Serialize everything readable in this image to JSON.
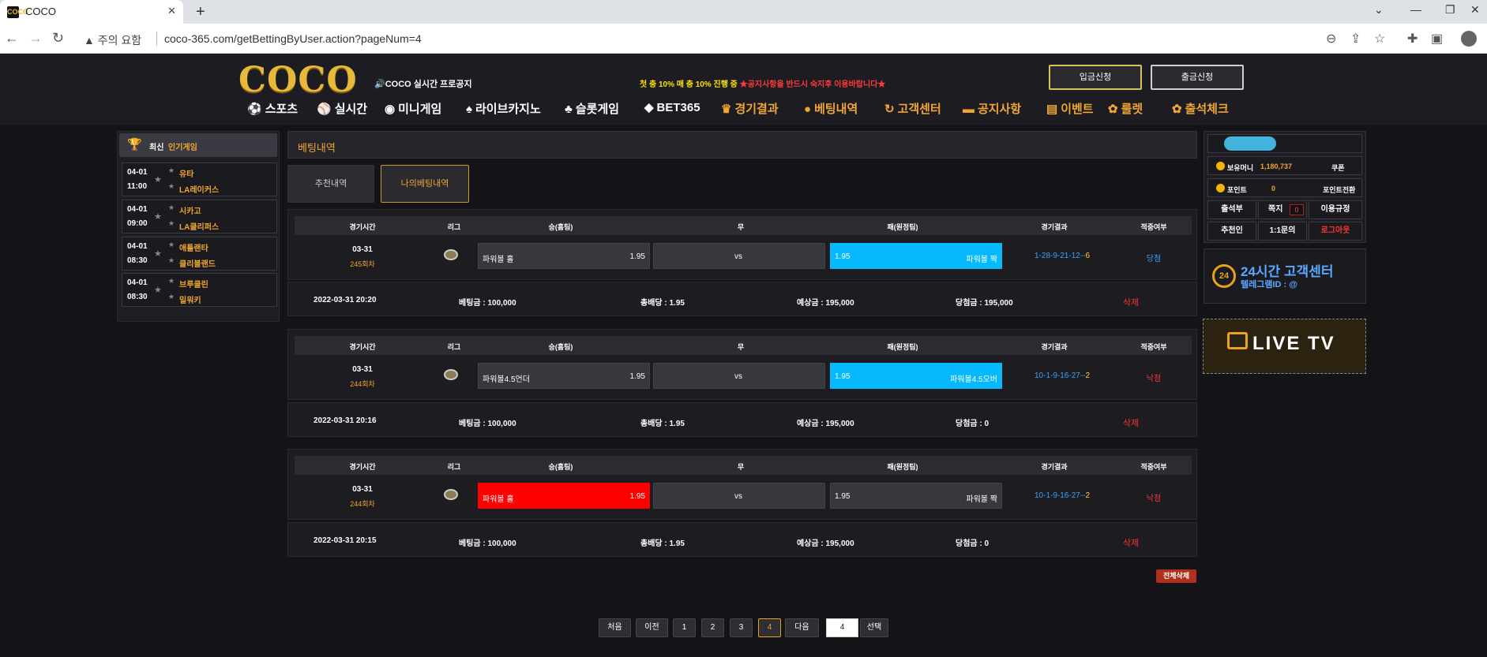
{
  "browser": {
    "tab_title": "COCO",
    "tab_favicon": "COCO",
    "security_label": "주의 요함",
    "url": "coco-365.com/getBettingByUser.action?pageNum=4"
  },
  "header": {
    "logo": "COCO",
    "notice_label": "🔊COCO 실시간 프로공지",
    "promo_yellow": "첫 충 10% 매 충 10% 진행 중",
    "promo_red": " ★공지사항을 반드시 숙지후 이용바랍니다★",
    "deposit_label": "입금신청",
    "withdraw_label": "출금신청",
    "menu": [
      {
        "label": "스포츠",
        "icon": "⚽",
        "color": "#ffffff"
      },
      {
        "label": "실시간",
        "icon": "⚾",
        "color": "#ffffff"
      },
      {
        "label": "미니게임",
        "icon": "◉",
        "color": "#ffffff"
      },
      {
        "label": "라이브카지노",
        "icon": "♠",
        "color": "#ffffff"
      },
      {
        "label": "슬롯게임",
        "icon": "♣",
        "color": "#ffffff"
      },
      {
        "label": "BET365",
        "icon": "◆",
        "color": "#ffffff"
      },
      {
        "label": "경기결과",
        "icon": "♛",
        "color": "#f0a630"
      },
      {
        "label": "베팅내역",
        "icon": "●",
        "color": "#f0a630"
      },
      {
        "label": "고객센터",
        "icon": "↻",
        "color": "#f0a630"
      },
      {
        "label": "공지사항",
        "icon": "▬",
        "color": "#f0a630"
      },
      {
        "label": "이벤트",
        "icon": "▤",
        "color": "#f0a630"
      },
      {
        "label": "룰렛",
        "icon": "✿",
        "color": "#f0a630"
      },
      {
        "label": "출석체크",
        "icon": "✿",
        "color": "#f0a630"
      }
    ]
  },
  "sidebar": {
    "title_white": "최신",
    "title_orange": "인기게임",
    "games": [
      {
        "date": "04-01",
        "time": "11:00",
        "home": "유타",
        "away": "LA레이커스"
      },
      {
        "date": "04-01",
        "time": "09:00",
        "home": "시카고",
        "away": "LA클리퍼스"
      },
      {
        "date": "04-01",
        "time": "08:30",
        "home": "애틀랜타",
        "away": "클리블랜드"
      },
      {
        "date": "04-01",
        "time": "08:30",
        "home": "브루클린",
        "away": "밀워키"
      }
    ]
  },
  "main": {
    "title": "베팅내역",
    "tabs": [
      "추천내역",
      "나의베팅내역"
    ],
    "columns": [
      "경기시간",
      "리그",
      "승(홈팀)",
      "무",
      "패(원정팀)",
      "경기결과",
      "적중여부"
    ],
    "bets": [
      {
        "date": "03-31",
        "round": "245회차",
        "home_name": "파워볼 홀",
        "home_odds": "1.95",
        "draw": "vs",
        "away_name": "파워볼 짝",
        "away_odds": "1.95",
        "result_nums": "1-28-9-21-12--",
        "result_sum": "6",
        "status": "당첨",
        "status_color": "#3aa3ff",
        "selected": "away",
        "summary": {
          "datetime": "2022-03-31 20:20",
          "bet": "베팅금 : 100,000",
          "total_odds": "총배당 : 1.95",
          "expected": "예상금 : 195,000",
          "win": "당첨금 : 195,000",
          "delete": "삭제"
        }
      },
      {
        "date": "03-31",
        "round": "244회차",
        "home_name": "파워볼4.5언더",
        "home_odds": "1.95",
        "draw": "vs",
        "away_name": "파워볼4.5오버",
        "away_odds": "1.95",
        "result_nums": "10-1-9-16-27--",
        "result_sum": "2",
        "status": "낙첨",
        "status_color": "#ff3333",
        "selected": "away",
        "summary": {
          "datetime": "2022-03-31 20:16",
          "bet": "베팅금 : 100,000",
          "total_odds": "총배당 : 1.95",
          "expected": "예상금 : 195,000",
          "win": "당첨금 : 0",
          "delete": "삭제"
        }
      },
      {
        "date": "03-31",
        "round": "244회차",
        "home_name": "파워볼 홀",
        "home_odds": "1.95",
        "draw": "vs",
        "away_name": "파워볼 짝",
        "away_odds": "1.95",
        "result_nums": "10-1-9-16-27--",
        "result_sum": "2",
        "status": "낙첨",
        "status_color": "#ff3333",
        "selected": "home",
        "summary": {
          "datetime": "2022-03-31 20:15",
          "bet": "베팅금 : 100,000",
          "total_odds": "총배당 : 1.95",
          "expected": "예상금 : 195,000",
          "win": "당첨금 : 0",
          "delete": "삭제"
        }
      }
    ],
    "delete_all": "전체삭제"
  },
  "pagination": {
    "first": "처음",
    "prev": "이전",
    "pages": [
      "1",
      "2",
      "3",
      "4"
    ],
    "current": "4",
    "next": "다음",
    "input_value": "4",
    "go": "선택"
  },
  "account": {
    "money_label": "보유머니",
    "money_value": "1,180,737",
    "coupon": "쿠폰",
    "point_label": "포인트",
    "point_value": "0",
    "point_convert": "포인트전환",
    "attendance": "출석부",
    "notes": "쪽지",
    "notes_count": "0",
    "rules": "이용규정",
    "referrer": "추천인",
    "inquiry": "1:1문의",
    "logout": "로그아웃"
  },
  "support": {
    "badge": "24",
    "title": "24시간 고객센터",
    "telegram": "텔레그램ID : @"
  },
  "live": {
    "label": "LIVE TV"
  }
}
